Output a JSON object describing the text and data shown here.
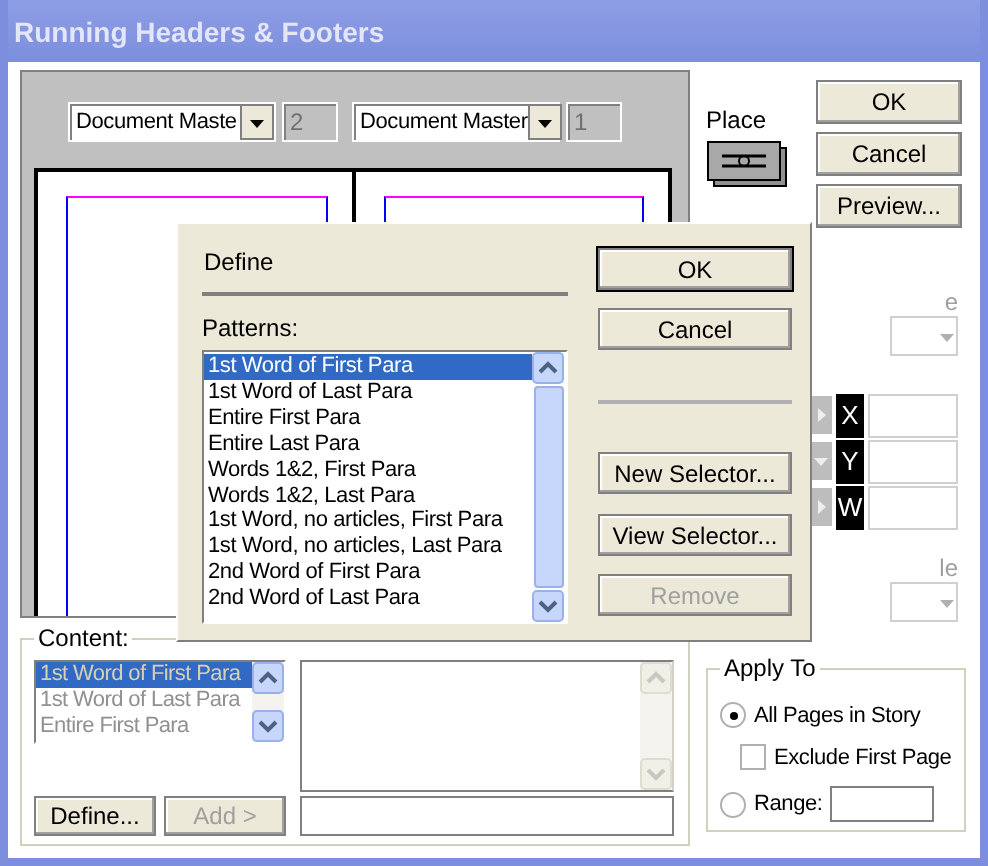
{
  "window": {
    "title": "Running Headers & Footers"
  },
  "masters": [
    {
      "value": "Document Maste",
      "page": "2"
    },
    {
      "value": "Document Master",
      "page": "1"
    }
  ],
  "place": {
    "label": "Place"
  },
  "buttons": [
    {
      "label": "OK"
    },
    {
      "label": "Cancel"
    },
    {
      "label": "Preview..."
    }
  ],
  "position": {
    "label_1": "e",
    "fields": [
      {
        "label": "X",
        "kind": "right"
      },
      {
        "label": "Y",
        "kind": "down"
      },
      {
        "label": "W",
        "kind": "right"
      }
    ],
    "label_2": "le"
  },
  "content": {
    "label": "Content:",
    "disabled": true,
    "items": [
      {
        "text": "1st Word of First Para",
        "selected": true
      },
      {
        "text": "1st Word of Last Para",
        "selected": false
      },
      {
        "text": "Entire First Para",
        "selected": false
      }
    ],
    "buttons": [
      {
        "label": "Define...",
        "disabled": false
      },
      {
        "label": "Add >",
        "disabled": true
      }
    ]
  },
  "apply_to": {
    "label": "Apply To",
    "options": [
      {
        "kind": "radio",
        "label": "All Pages in Story",
        "selected": true
      },
      {
        "kind": "checkbox",
        "label": "Exclude First Page",
        "checked": false
      },
      {
        "kind": "radio",
        "label": "Range:",
        "selected": false
      }
    ]
  },
  "define_dialog": {
    "title": "Define",
    "patterns_label": "Patterns:",
    "patterns": [
      {
        "text": "1st Word of First Para",
        "selected": true
      },
      {
        "text": "1st Word of Last Para",
        "selected": false
      },
      {
        "text": "Entire First Para",
        "selected": false
      },
      {
        "text": "Entire Last Para",
        "selected": false
      },
      {
        "text": "Words 1&2, First Para",
        "selected": false
      },
      {
        "text": "Words 1&2, Last Para",
        "selected": false
      },
      {
        "text": "1st Word, no articles, First Para",
        "selected": false
      },
      {
        "text": "1st Word, no articles, Last Para",
        "selected": false
      },
      {
        "text": "2nd Word of First Para",
        "selected": false
      },
      {
        "text": "2nd Word of Last Para",
        "selected": false
      }
    ],
    "buttons": [
      {
        "label": "OK",
        "disabled": false,
        "default": true
      },
      {
        "label": "Cancel",
        "disabled": false,
        "default": false
      },
      {
        "label": "New  Selector...",
        "disabled": false,
        "default": false
      },
      {
        "label": "View Selector...",
        "disabled": false,
        "default": false
      },
      {
        "label": "Remove",
        "disabled": true,
        "default": false
      }
    ]
  }
}
